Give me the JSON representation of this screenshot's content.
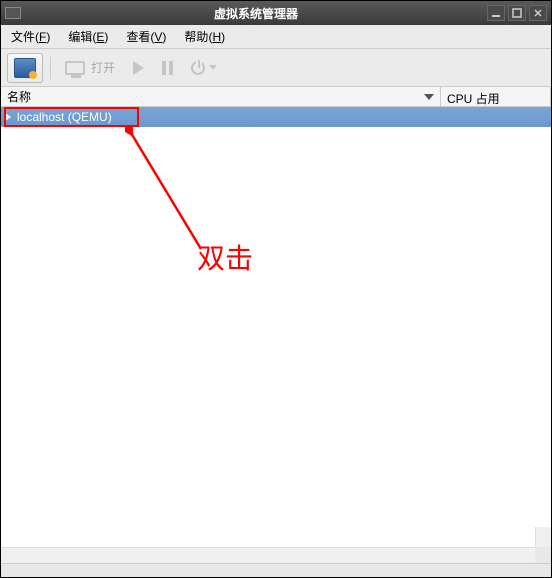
{
  "window": {
    "title": "虚拟系统管理器"
  },
  "menu": {
    "file": {
      "label": "文件",
      "mnemonic": "F"
    },
    "edit": {
      "label": "编辑",
      "mnemonic": "E"
    },
    "view": {
      "label": "查看",
      "mnemonic": "V"
    },
    "help": {
      "label": "帮助",
      "mnemonic": "H"
    }
  },
  "toolbar": {
    "open_label": "打开"
  },
  "columns": {
    "name": "名称",
    "cpu": "CPU 占用"
  },
  "hosts": [
    {
      "label": "localhost (QEMU)",
      "expanded": false,
      "selected": true
    }
  ],
  "annotation": {
    "text": "双击"
  }
}
